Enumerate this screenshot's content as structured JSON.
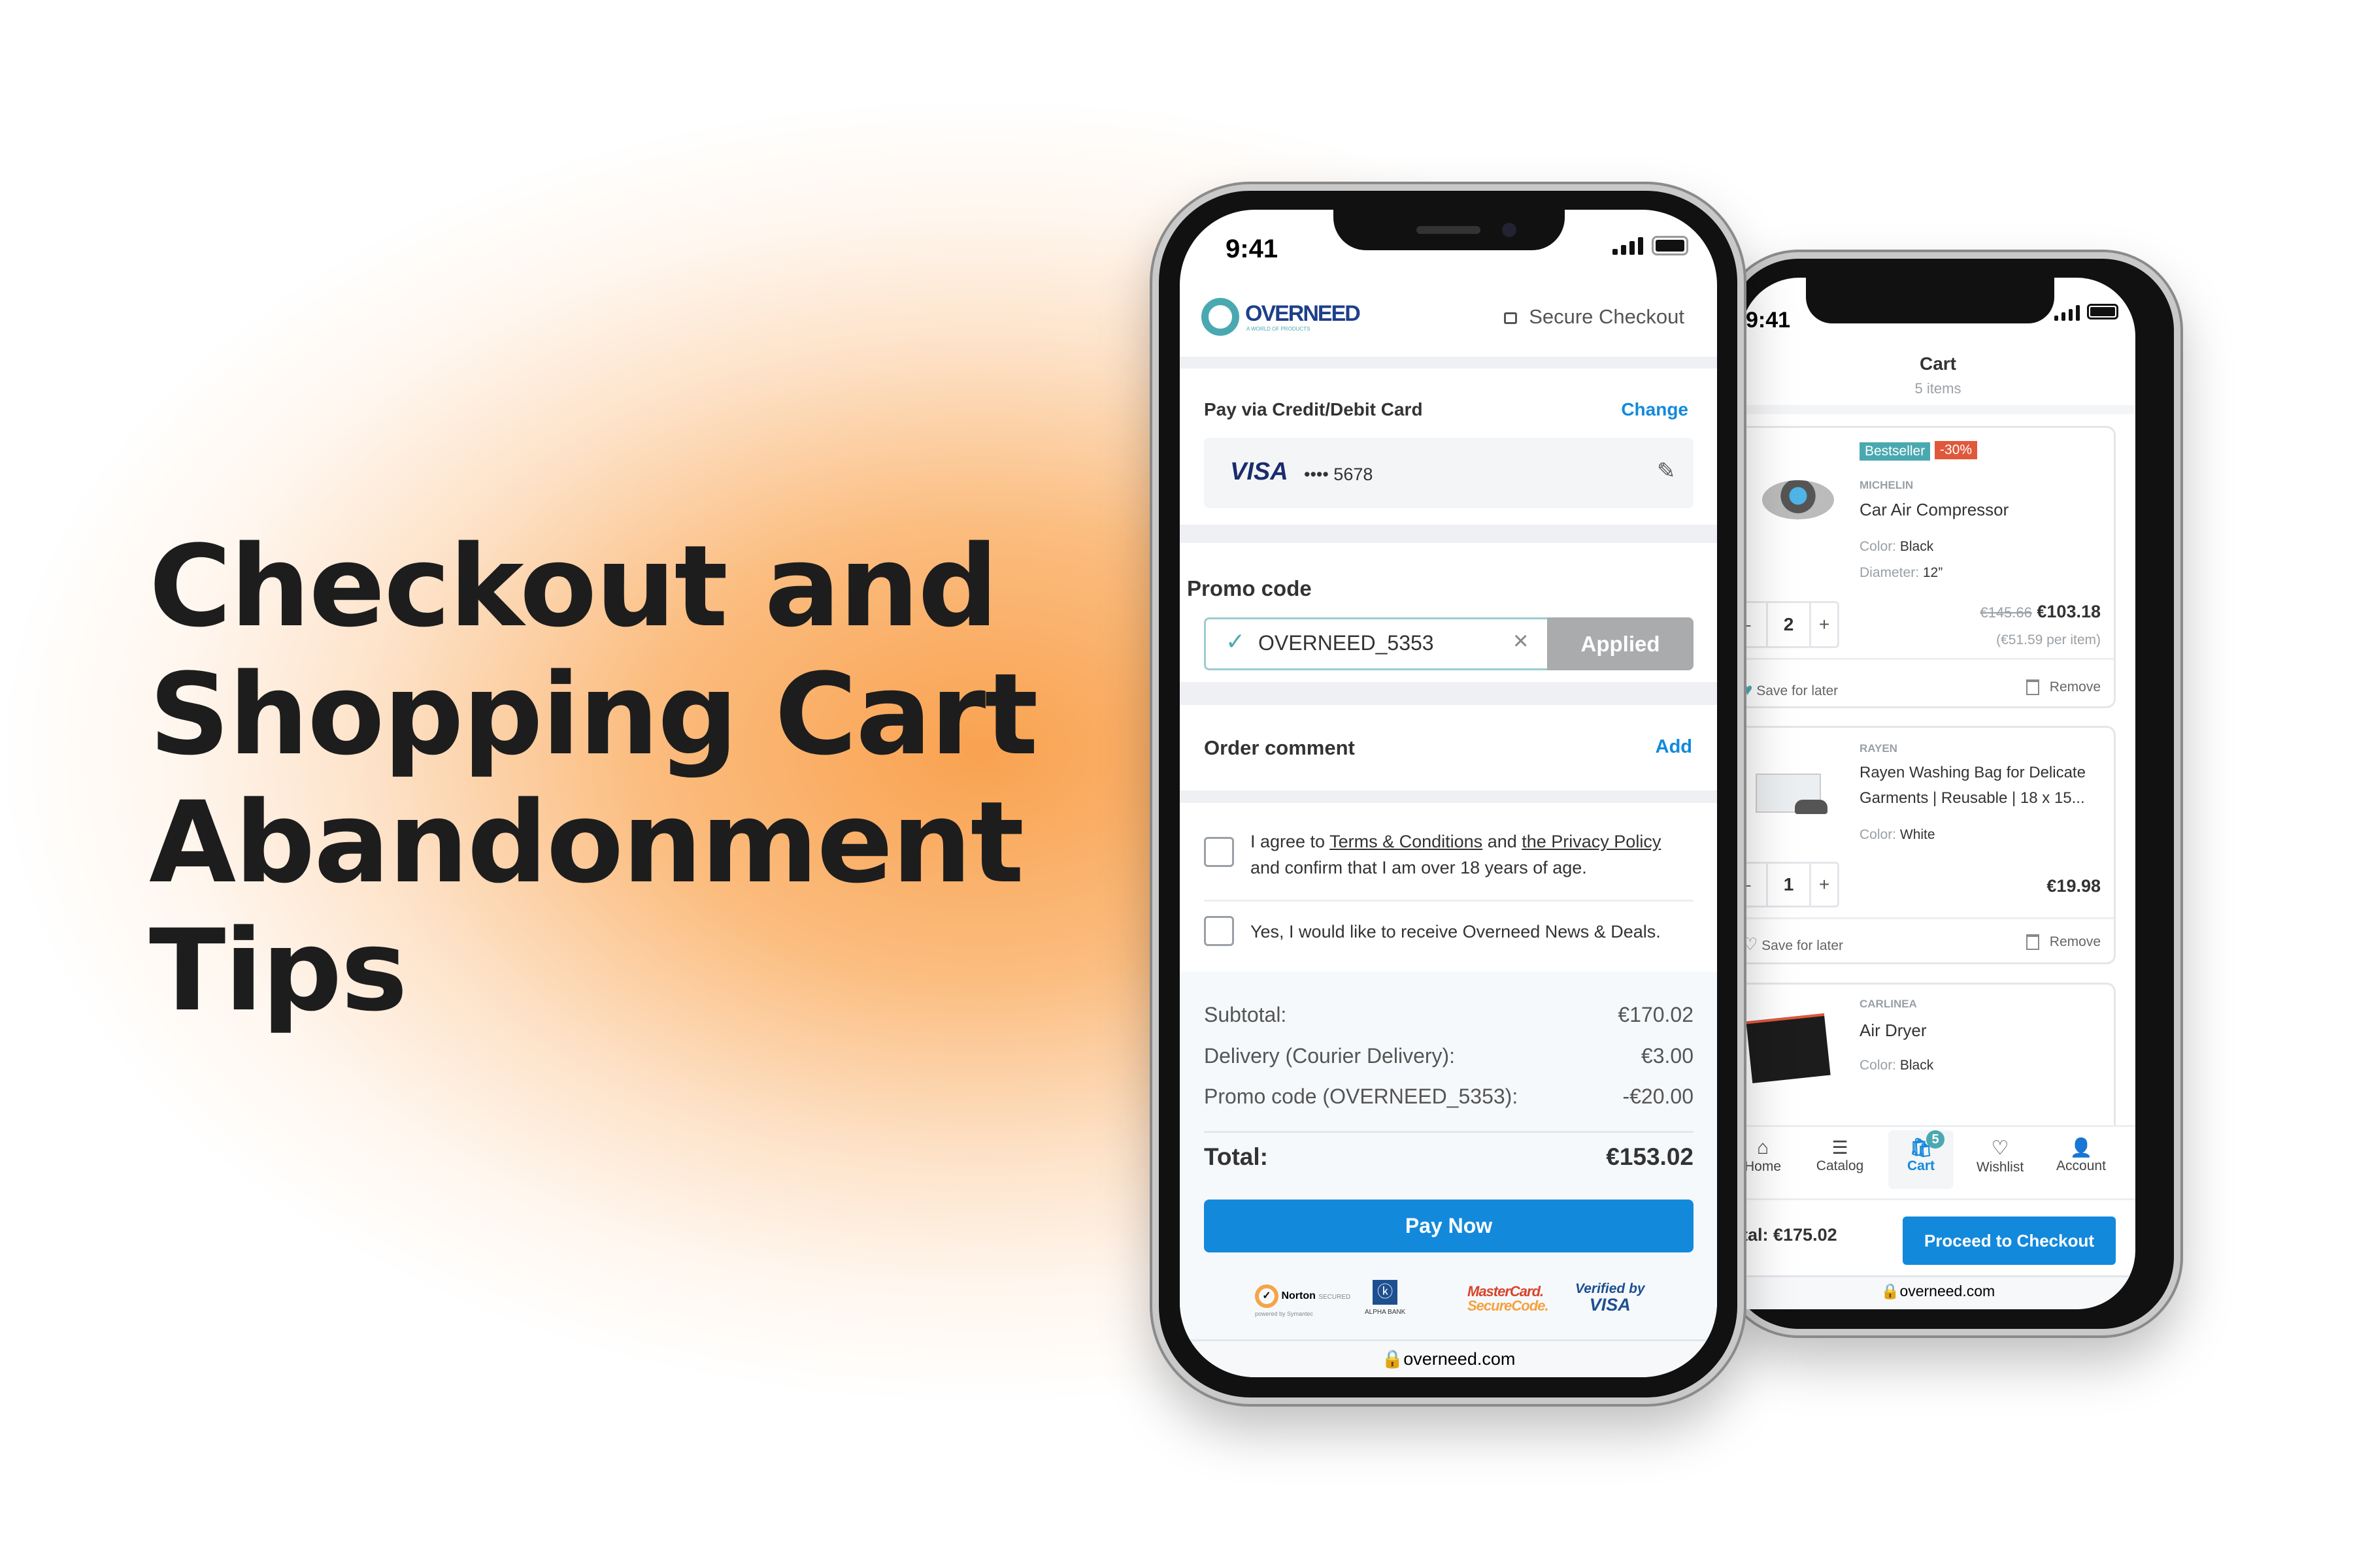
{
  "headline": [
    "Checkout and",
    "Shopping Cart",
    "Abandonment",
    "Tips"
  ],
  "colors": {
    "accent_blue": "#1389dc",
    "teal": "#4aa9b0",
    "orange_glow": "#f9a250",
    "discount_red": "#e0583c"
  },
  "checkout": {
    "status_time": "9:41",
    "logo_text": "OVERNEED",
    "logo_tagline": "A WORLD OF PRODUCTS",
    "secure_label": "Secure Checkout",
    "payment": {
      "title": "Pay via Credit/Debit Card",
      "change_label": "Change",
      "card_brand": "VISA",
      "card_number": "•••• 5678"
    },
    "promo": {
      "title": "Promo code",
      "value": "OVERNEED_5353",
      "button_label": "Applied"
    },
    "order_comment": {
      "title": "Order comment",
      "add_label": "Add"
    },
    "terms": {
      "prefix": "I agree to ",
      "link1": "Terms & Conditions",
      "mid": " and ",
      "link2": "the Privacy Policy",
      "line2": "and confirm that I am over 18 years of age.",
      "checked": false
    },
    "newsletter": {
      "label": "Yes, I would like to receive Overneed News & Deals.",
      "checked": false
    },
    "summary": [
      {
        "label": "Subtotal:",
        "value": "€170.02"
      },
      {
        "label": "Delivery (Courier Delivery):",
        "value": "€3.00"
      },
      {
        "label": "Promo code (OVERNEED_5353):",
        "value": "-€20.00"
      }
    ],
    "total": {
      "label": "Total:",
      "value": "€153.02"
    },
    "pay_button": "Pay Now",
    "trust_logos": {
      "norton": "Norton",
      "norton_sub": "SECURED",
      "norton_powered": "powered by Symantec",
      "alpha": "ALPHA BANK",
      "mc1": "MasterCard.",
      "mc2": "SecureCode.",
      "vbv1": "Verified by",
      "vbv2": "VISA"
    },
    "url": "overneed.com"
  },
  "cart": {
    "status_time": "9:41",
    "title": "Cart",
    "subtitle": "5 items",
    "items": [
      {
        "badges": [
          "Bestseller",
          "-30%"
        ],
        "brand": "MICHELIN",
        "name": "Car Air Compressor",
        "attrs": [
          {
            "k": "Color:",
            "v": "Black"
          },
          {
            "k": "Diameter:",
            "v": "12”"
          }
        ],
        "qty": "2",
        "old_price": "€145.66",
        "price": "€103.18",
        "per_item": "(€51.59 per item)",
        "saved": true
      },
      {
        "brand": "RAYEN",
        "name_line1": "Rayen Washing Bag for Delicate",
        "name_line2": "Garments | Reusable | 18 x 15...",
        "attrs": [
          {
            "k": "Color:",
            "v": "White"
          }
        ],
        "qty": "1",
        "price": "€19.98",
        "saved": false
      },
      {
        "brand": "CARLINEA",
        "name": "Air Dryer",
        "attrs": [
          {
            "k": "Color:",
            "v": "Black"
          }
        ]
      }
    ],
    "save_label": "Save for later",
    "remove_label": "Remove",
    "nav": [
      {
        "label": "Home",
        "icon": "home-icon"
      },
      {
        "label": "Catalog",
        "icon": "catalog-search-icon"
      },
      {
        "label": "Cart",
        "icon": "cart-icon",
        "badge": "5",
        "active": true
      },
      {
        "label": "Wishlist",
        "icon": "heart-icon"
      },
      {
        "label": "Account",
        "icon": "user-icon"
      }
    ],
    "total": "tal: €175.02",
    "checkout_button": "Proceed to Checkout",
    "url": "overneed.com"
  }
}
